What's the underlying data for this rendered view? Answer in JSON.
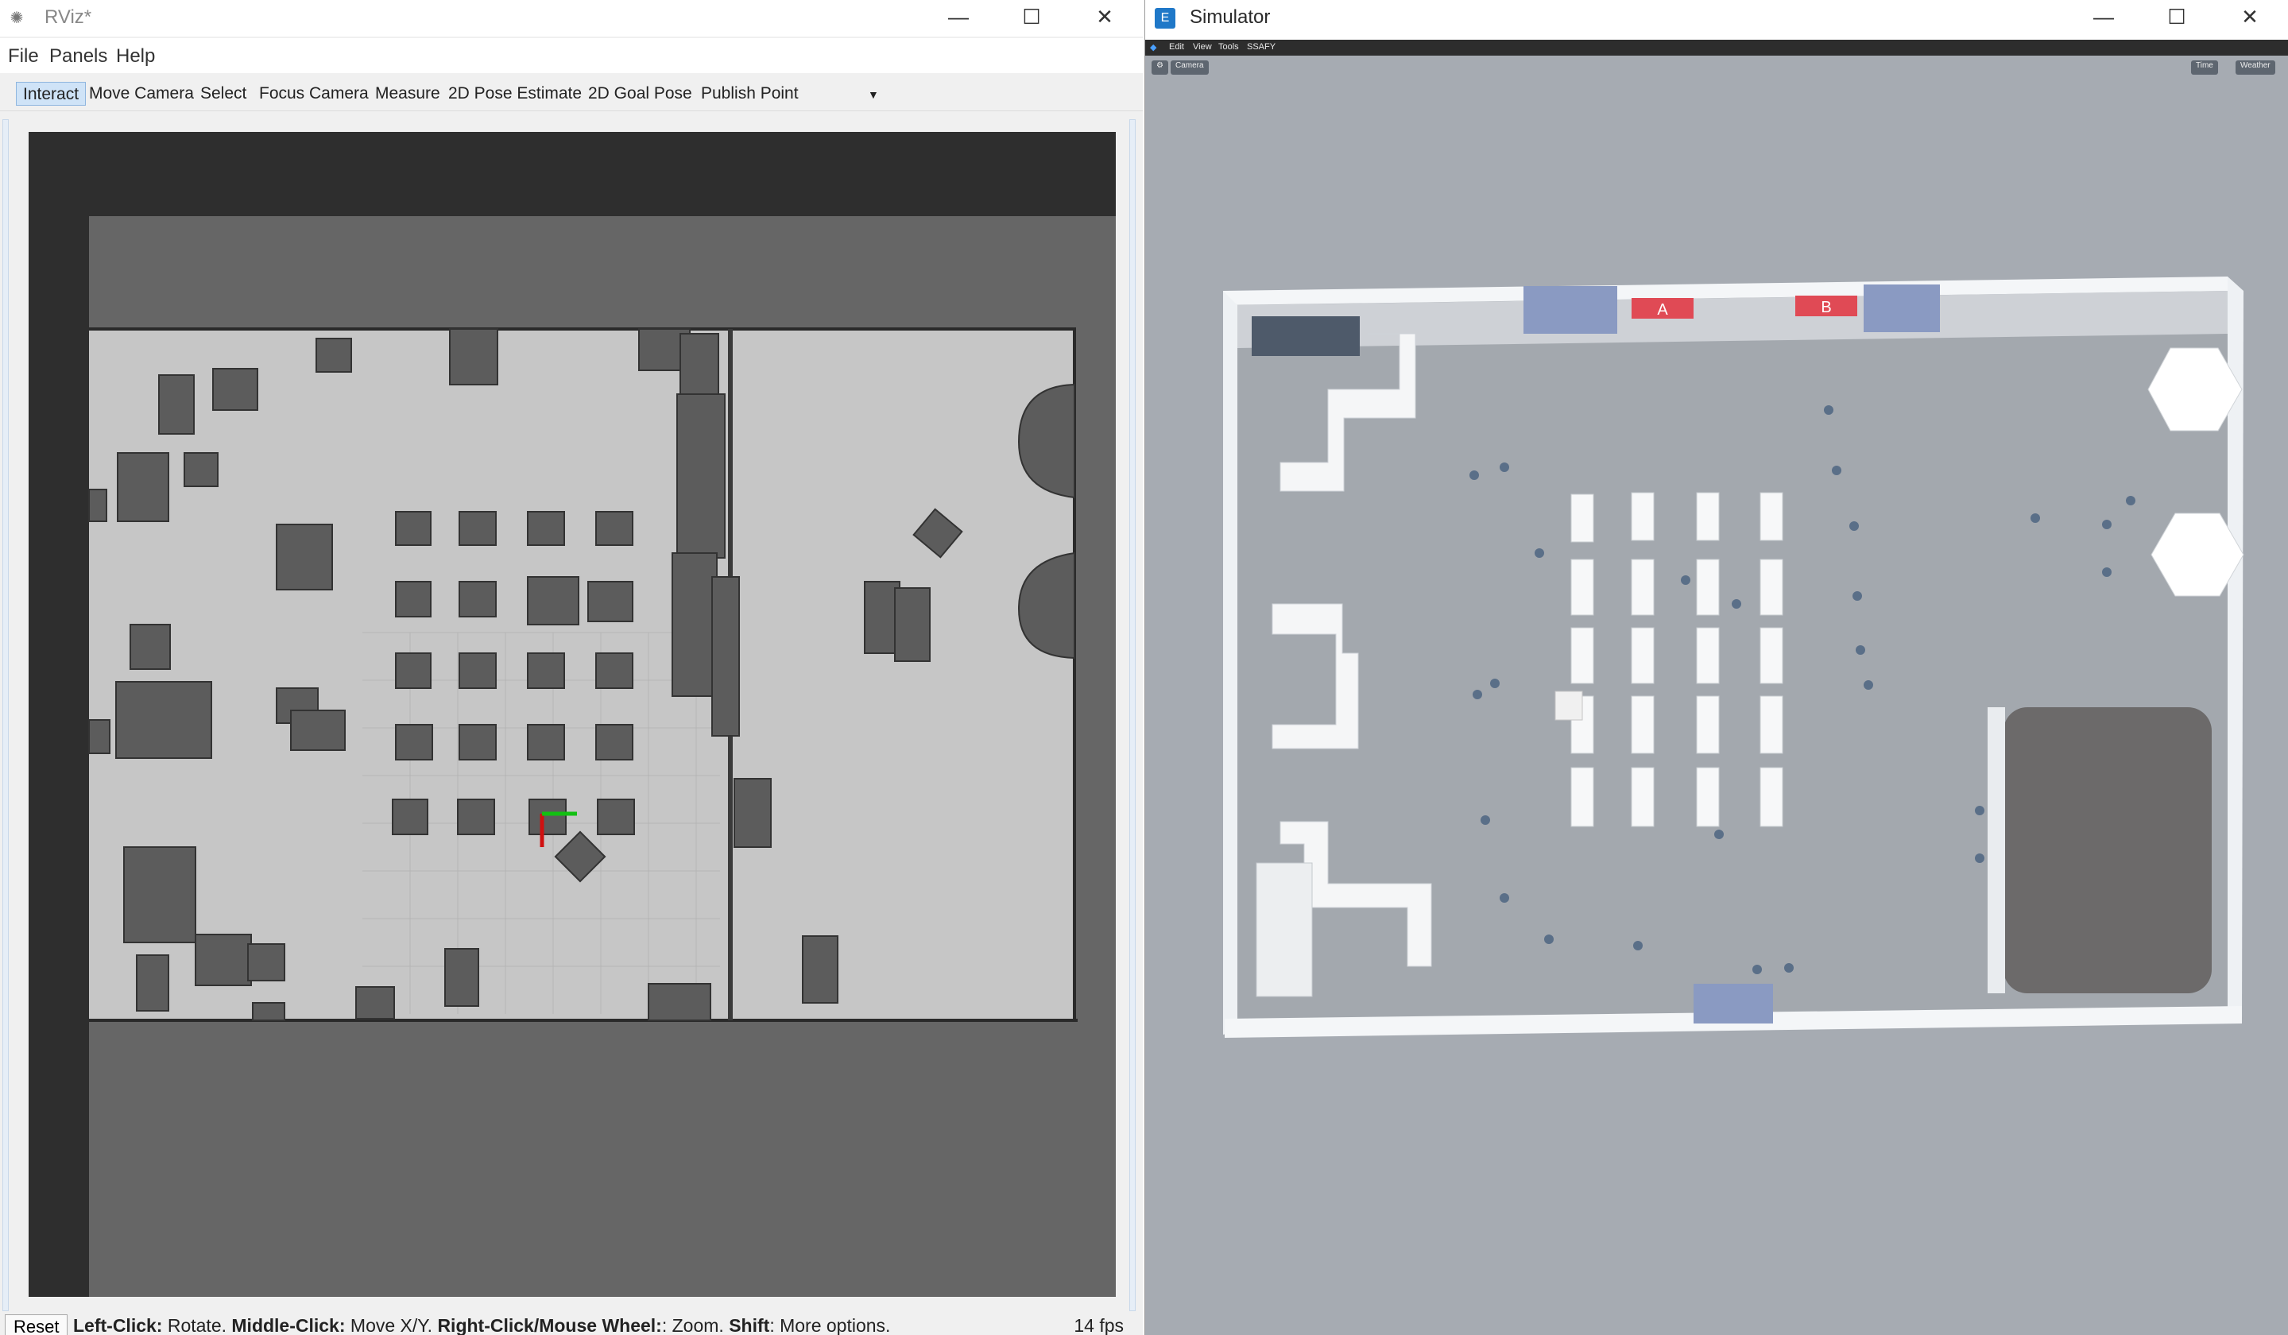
{
  "rviz": {
    "title": "RViz*",
    "menu": [
      "File",
      "Panels",
      "Help"
    ],
    "tools": [
      "Interact",
      "Move Camera",
      "Select",
      "Focus Camera",
      "Measure",
      "2D Pose Estimate",
      "2D Goal Pose",
      "Publish Point"
    ],
    "active_tool": "Interact",
    "status": {
      "reset": "Reset",
      "k1": "Left-Click:",
      "v1": " Rotate. ",
      "k2": "Middle-Click:",
      "v2": " Move X/Y. ",
      "k3": "Right-Click/Mouse Wheel:",
      "v3": ": Zoom. ",
      "k4": "Shift",
      "v4": ": More options.",
      "fps": "14 fps"
    }
  },
  "simulator": {
    "title": "Simulator",
    "menu": [
      "Edit",
      "View",
      "Tools",
      "SSAFY"
    ],
    "camera_btn": "Camera",
    "time_btn": "Time",
    "weather_btn": "Weather",
    "gate_a": "A",
    "gate_b": "B"
  },
  "colors": {
    "occupied": "#5a5a5a",
    "free": "#c8c8c8",
    "unknown": "#585858",
    "floor": "#a3a8ae",
    "wall": "#eef1f4",
    "gate": "#e04a55"
  }
}
